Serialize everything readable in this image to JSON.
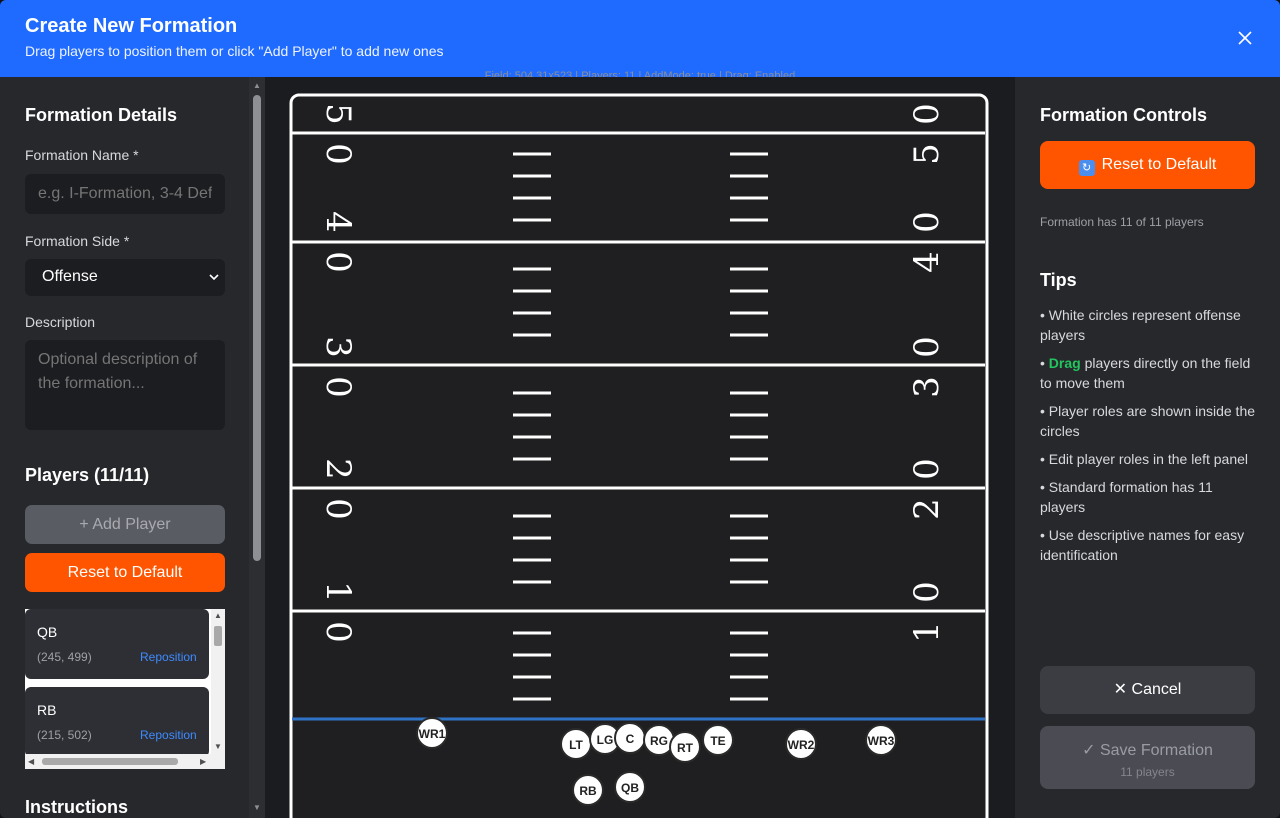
{
  "header": {
    "title": "Create New Formation",
    "subtitle": "Drag players to position them or click \"Add Player\" to add new ones"
  },
  "debug_text": "Field: 504.31x523 | Players: 11 | AddMode: true | Drag: Enabled",
  "left": {
    "details_heading": "Formation Details",
    "name_label": "Formation Name *",
    "name_placeholder": "e.g. I-Formation, 3-4 Defense",
    "name_value": "",
    "side_label": "Formation Side *",
    "side_value": "Offense",
    "description_label": "Description",
    "description_placeholder": "Optional description of the formation...",
    "players_heading": "Players (11/11)",
    "add_player_label": "+ Add Player",
    "reset_label": "Reset to Default",
    "players": [
      {
        "role": "QB",
        "pos": "(245, 499)",
        "action": "Reposition"
      },
      {
        "role": "RB",
        "pos": "(215, 502)",
        "action": "Reposition"
      }
    ],
    "instructions_heading": "Instructions"
  },
  "field": {
    "yard_lines": [
      {
        "left": [
          "5",
          "0"
        ],
        "right": [
          "5",
          "0"
        ]
      },
      {
        "left": [
          "4",
          "0"
        ],
        "right": [
          "4",
          "0"
        ]
      },
      {
        "left": [
          "3",
          "0"
        ],
        "right": [
          "3",
          "0"
        ]
      },
      {
        "left": [
          "2",
          "0"
        ],
        "right": [
          "2",
          "0"
        ]
      },
      {
        "left": [
          "1",
          "0"
        ],
        "right": [
          "1",
          "0"
        ]
      }
    ],
    "players": [
      "WR1",
      "LT",
      "LG",
      "C",
      "RG",
      "RT",
      "TE",
      "WR2",
      "WR3",
      "RB",
      "QB"
    ]
  },
  "right": {
    "controls_heading": "Formation Controls",
    "reset_label": "Reset to Default",
    "count_text": "Formation has 11 of 11 players",
    "tips_heading": "Tips",
    "tips": [
      {
        "pre": "• White circles represent offense players",
        "hl": "",
        "post": ""
      },
      {
        "pre": "• ",
        "hl": "Drag",
        "post": " players directly on the field to move them"
      },
      {
        "pre": "• Player roles are shown inside the circles",
        "hl": "",
        "post": ""
      },
      {
        "pre": "• Edit player roles in the left panel",
        "hl": "",
        "post": ""
      },
      {
        "pre": "• Standard formation has 11 players",
        "hl": "",
        "post": ""
      },
      {
        "pre": "• Use descriptive names for easy identification",
        "hl": "",
        "post": ""
      }
    ],
    "cancel_label": "Cancel",
    "save_label": "✓ Save Formation",
    "save_sub": "11 players"
  },
  "colors": {
    "header": "#1f6bff",
    "accent_orange": "#ff5400",
    "line_of_scrimmage": "#2f73c6",
    "tip_highlight": "#22c55e"
  }
}
